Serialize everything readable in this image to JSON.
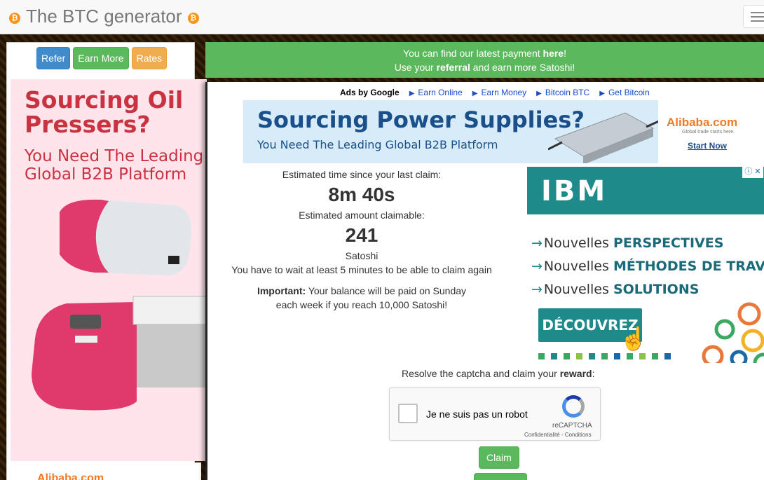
{
  "header": {
    "title": "The BTC generator",
    "coin_glyph": "₿"
  },
  "left_panel": {
    "buttons": [
      {
        "label": "Refer",
        "color": "#428bca"
      },
      {
        "label": "Earn More",
        "color": "#5cb85c"
      },
      {
        "label": "Rates",
        "color": "#f0ad4e"
      }
    ],
    "ad": {
      "headline": "Sourcing Oil Pressers?",
      "subline_1": "You Need The Leading",
      "subline_2": "Global B2B Platform",
      "footer_brand": "Alibaba.com"
    }
  },
  "banner": {
    "line1_prefix": "You can find our latest payment ",
    "line1_link": "here",
    "line1_suffix": "!",
    "line2_prefix": "Use your ",
    "line2_bold": "referral",
    "line2_suffix": " and earn more Satoshi!"
  },
  "ad_links": {
    "label": "Ads by Google",
    "links": [
      "Earn Online",
      "Earn Money",
      "Bitcoin BTC",
      "Get Bitcoin"
    ]
  },
  "power_ad": {
    "headline": "Sourcing Power Supplies?",
    "subline": "You Need The Leading Global B2B Platform",
    "brand": "Alibaba.com",
    "brand_tagline": "Global trade starts here.",
    "cta": "Start Now"
  },
  "stats": {
    "time_label": "Estimated time since your last claim:",
    "time_value": "8m 40s",
    "amount_label": "Estimated amount claimable:",
    "amount_value": "241",
    "unit": "Satoshi",
    "wait_note": "You have to wait at least 5 minutes to be able to claim again",
    "important_label": "Important:",
    "important_text": " Your balance will be paid on Sunday each week if you reach 10,000 Satoshi!"
  },
  "ibm_ad": {
    "logo": "IBM",
    "prefix": "Nouvelles",
    "items": [
      "PERSPECTIVES",
      "MÉTHODES DE TRAVAIL",
      "SOLUTIONS"
    ],
    "cta": "DÉCOUVREZ",
    "close": "ⓘ ✕"
  },
  "captcha": {
    "prompt_prefix": "Resolve the captcha and claim your ",
    "prompt_bold": "reward",
    "prompt_suffix": ":",
    "checkbox_label": "Je ne suis pas un robot",
    "brand": "reCAPTCHA",
    "terms": "Confidentialité - Conditions"
  },
  "claim_button": "Claim"
}
